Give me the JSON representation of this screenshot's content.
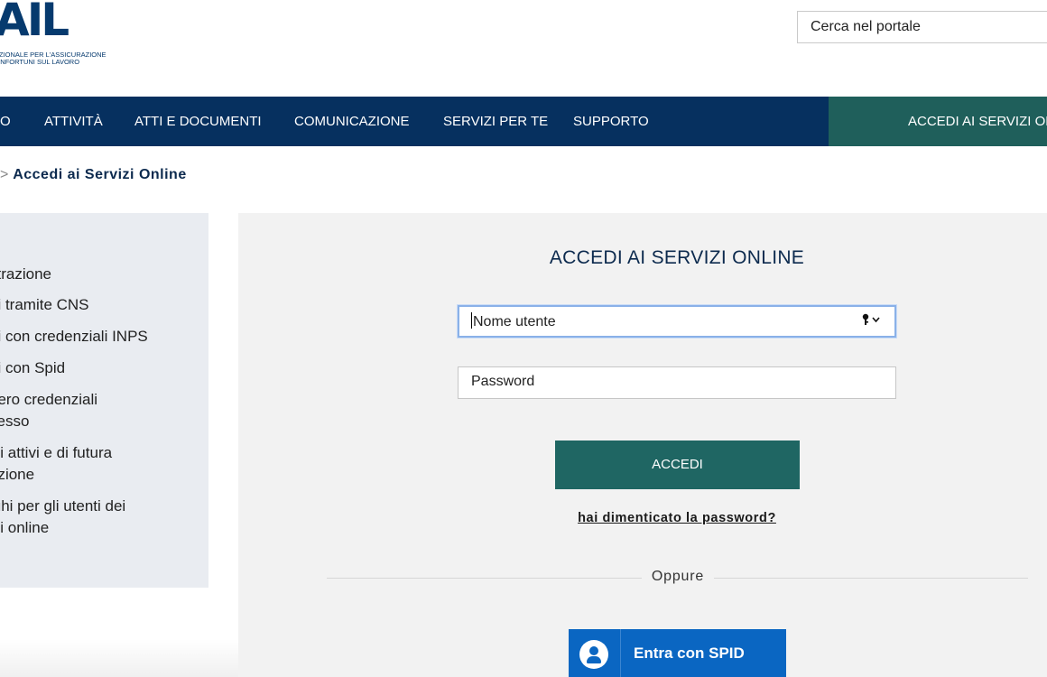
{
  "header": {
    "logo_text": "AIL",
    "logo_subtitle_line1": "AZIONALE PER L'ASSICURAZIONE",
    "logo_subtitle_line2": "I INFORTUNI SUL LAVORO",
    "search_placeholder": "Cerca nel portale"
  },
  "nav": {
    "items": [
      {
        "label": "O"
      },
      {
        "label": "ATTIVITÀ"
      },
      {
        "label": "ATTI E DOCUMENTI"
      },
      {
        "label": "COMUNICAZIONE"
      },
      {
        "label": "SERVIZI PER TE"
      },
      {
        "label": "SUPPORTO"
      }
    ],
    "cta_label": "ACCEDI AI SERVIZI ONLINE",
    "color_primary": "#06305f",
    "color_cta": "#1f5f5b"
  },
  "breadcrumb": {
    "separator": ">",
    "current": "Accedi ai Servizi Online"
  },
  "sidebar": {
    "items": [
      {
        "label": "strazione"
      },
      {
        "label": "di tramite CNS"
      },
      {
        "label": "di con credenziali INPS"
      },
      {
        "label": "di con Spid"
      },
      {
        "label_line1": "pero credenziali",
        "label_line2": "cesso"
      },
      {
        "label_line1": "izi attivi e di futura",
        "label_line2": "azione"
      },
      {
        "label_line1": "ighi per gli utenti dei",
        "label_line2": "izi online"
      }
    ]
  },
  "login": {
    "title": "ACCEDI AI SERVIZI ONLINE",
    "username_placeholder": "Nome utente",
    "username_icons": "key-dropdown-icon",
    "password_placeholder": "Password",
    "submit_label": "ACCEDI",
    "forgot_label": "hai dimenticato la password?",
    "divider_label": "Oppure",
    "spid_label": "Entra con SPID",
    "spid_icon": "user-icon",
    "accent_color": "#1f6663",
    "spid_color": "#0a66c2"
  }
}
